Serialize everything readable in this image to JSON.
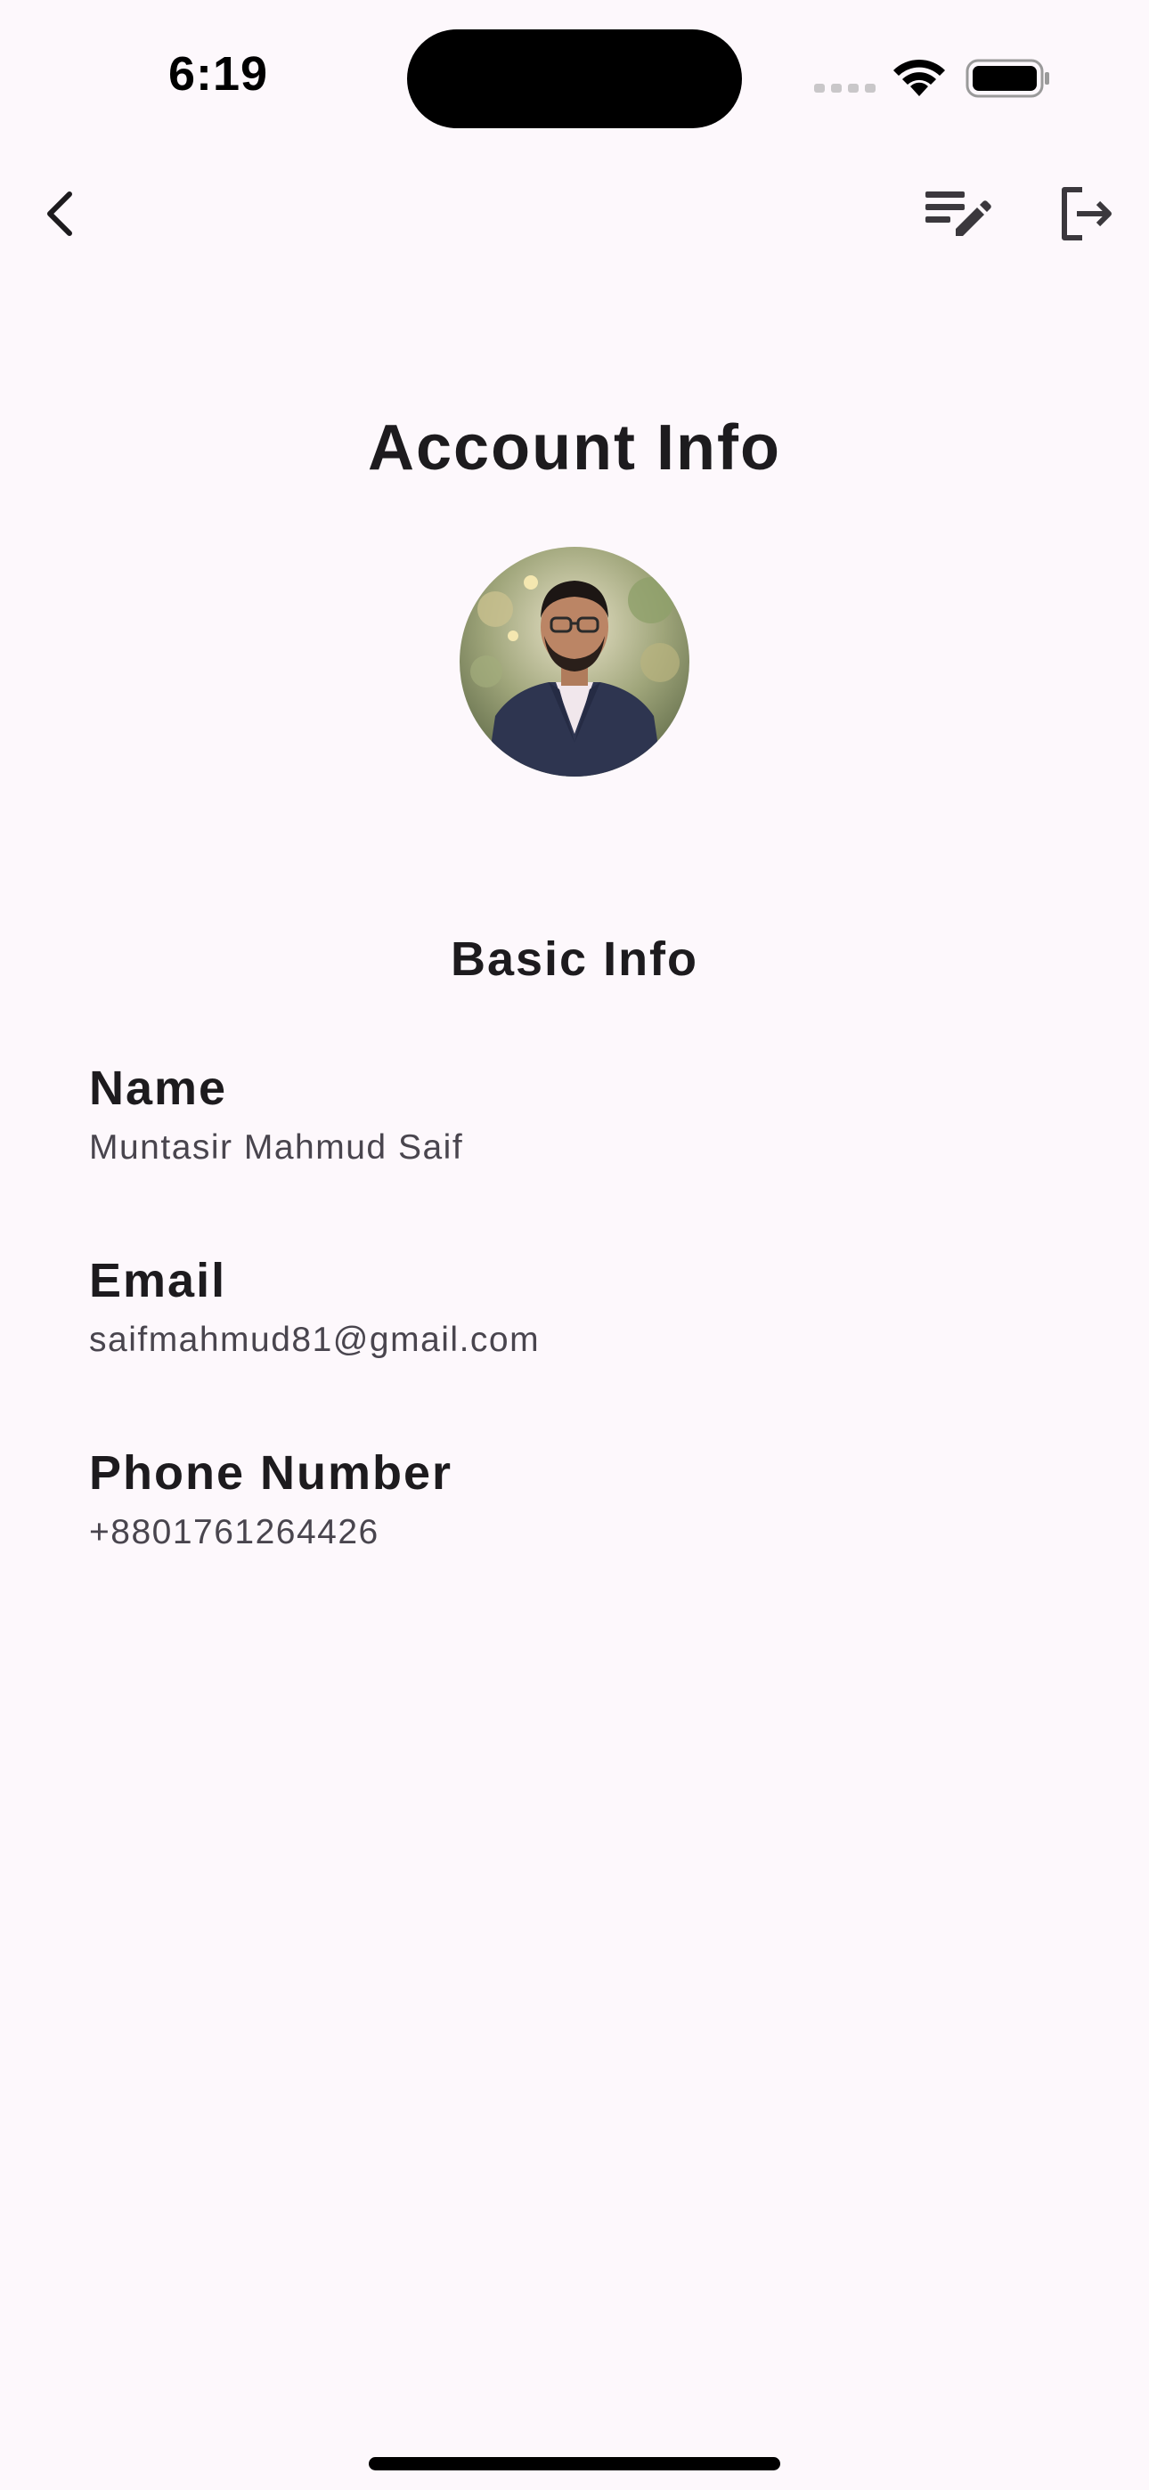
{
  "status_bar": {
    "time": "6:19"
  },
  "header": {
    "back_icon": "chevron-left-icon",
    "edit_icon": "edit-note-icon",
    "logout_icon": "logout-icon"
  },
  "page": {
    "title": "Account Info",
    "avatar_alt": "profile photo"
  },
  "basic_info": {
    "title": "Basic Info",
    "fields": [
      {
        "label": "Name",
        "value": "Muntasir Mahmud Saif"
      },
      {
        "label": "Email",
        "value": "saifmahmud81@gmail.com"
      },
      {
        "label": "Phone Number",
        "value": "+8801761264426"
      }
    ]
  },
  "colors": {
    "background": "#fdf8fc",
    "text_primary": "#1d1b1e",
    "text_secondary": "#49454e"
  }
}
